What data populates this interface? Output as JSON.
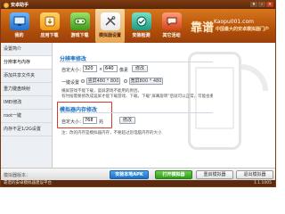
{
  "window": {
    "title": "安卓助手"
  },
  "toolbar": {
    "items": [
      {
        "label": "我的",
        "icon": "monitor-icon"
      },
      {
        "label": "应用下载",
        "icon": "app-download-icon"
      },
      {
        "label": "游戏下载",
        "icon": "game-controller-icon"
      },
      {
        "label": "模拟器设置",
        "icon": "tools-icon",
        "active": true
      },
      {
        "label": "安装检测",
        "icon": "check-icon"
      },
      {
        "label": "其它活动",
        "icon": "chat-icon"
      }
    ]
  },
  "brand": {
    "big": "靠谱",
    "site": "Kaopu001.com",
    "sub": "中国最大的安卓模拟器门户"
  },
  "sidebar": {
    "items": [
      {
        "label": "设置简介"
      },
      {
        "label": "分辨率与内存",
        "active": true
      },
      {
        "label": "添加共享文件夹"
      },
      {
        "label": "重力键盘映射"
      },
      {
        "label": "IMEI修改"
      },
      {
        "label": "root一键"
      },
      {
        "label": "内存不足1/2G设置"
      }
    ]
  },
  "resolution": {
    "title": "分辨率修改",
    "custom_label": "自定大小：",
    "width": "320",
    "times": "×",
    "height": "640",
    "unit": "像素",
    "apply_button": "修改",
    "onekey_label": "一键设置",
    "preset_portrait": "竖屏480 * 800",
    "preset_landscape": "宽屏800 * 480",
    "note1": "横屏游戏不能下载，竖屏游戏不能用的原因，",
    "note2": "有时候需要修改成竖屏才能下载游戏、下载，下载“屏幕旋转”后就可以正常，可能会重启"
  },
  "memory": {
    "title": "模拟器内存修改",
    "custom_label": "自定大小：",
    "value": "768",
    "unit": "兆",
    "apply_button": "修改",
    "note": "注：改的内存是模拟器内存，不要超过您电脑内存的大小"
  },
  "bottombar": {
    "left_text": "模拟器版本：",
    "install_button": "安装本地APK",
    "open_button": "打开模拟器",
    "restart_button": "重启模拟器",
    "exit_button": "退出模拟器"
  },
  "statusbar": {
    "text": "靠谱的安卓模拟器建设平台",
    "version": "1.1.1005"
  },
  "colors": {
    "toolbar": "#c0600f",
    "accent_blue": "#1c6fc2",
    "highlight_red": "#d23a2a"
  }
}
